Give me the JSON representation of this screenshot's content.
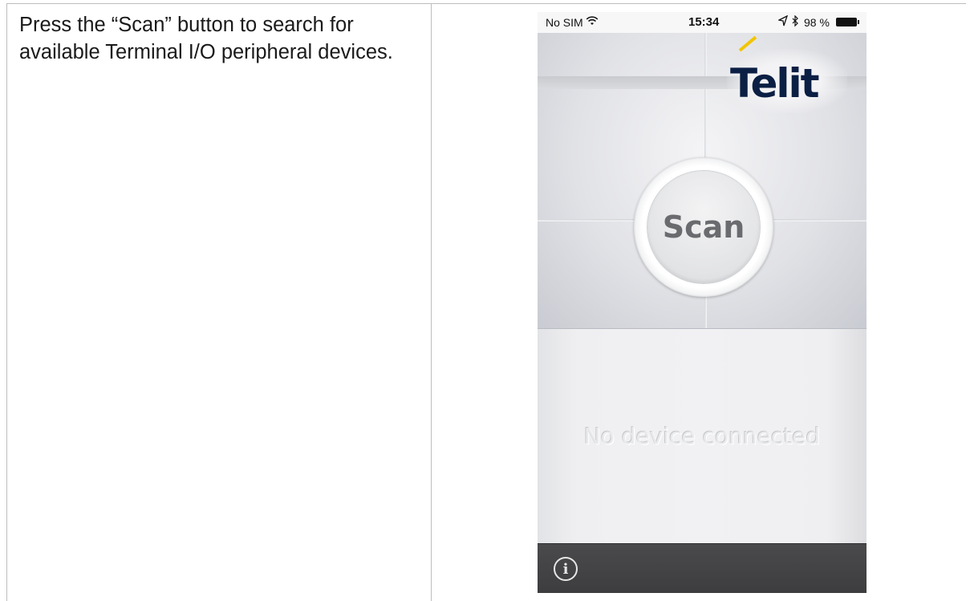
{
  "document": {
    "instruction": "Press the “Scan” button to search for available Terminal I/O peripheral devices."
  },
  "phone": {
    "statusbar": {
      "carrier": "No SIM",
      "time": "15:34",
      "battery": "98 %",
      "icons": [
        "wifi-icon",
        "location-arrow-icon",
        "bluetooth-icon",
        "battery-icon"
      ]
    },
    "logo": "Telit",
    "scan_button": "Scan",
    "status_message": "No device connected",
    "bottombar": {
      "info_icon": "info-icon",
      "info_glyph": "i"
    },
    "colors": {
      "logo_navy": "#0b1f44",
      "logo_accent": "#f2c500",
      "bar": "#404042"
    }
  }
}
